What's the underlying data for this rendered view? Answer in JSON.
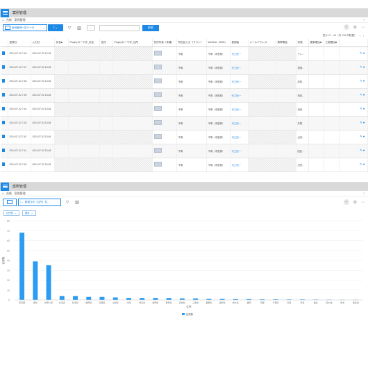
{
  "top": {
    "title": "案例管理",
    "breadcrumb": "台帐 · 案例管理",
    "breadcrumb_right": "›",
    "view_select": "案例管理一覧データ",
    "search_placeholder": "",
    "search_button": "检索",
    "dots": "…",
    "pager": "显示 21 - 40（共 795 件数据）",
    "columns": [
      "",
      "登録日",
      "入力日",
      "氏名■",
      "Pinyin(ローマ字_氏名",
      "住所",
      "Pinyin(ローマ字_住所",
      "在所写真（本通）",
      "所在区入力（ブラン）",
      "WeChat（SNS）",
      "登録者",
      "メールアドレス",
      "携帯電話",
      "状態",
      "提案理由■",
      "工程理由■",
      ""
    ],
    "rows": [
      {
        "reg": "2024-07-02 7:46",
        "input": "2024-07-02 13:48",
        "plan": "不明",
        "wechat": "不明（未登録）",
        "by": "代之信一",
        "status": "テレ…"
      },
      {
        "reg": "2024-07-02 7:47",
        "input": "2024-07-02 13:48",
        "plan": "不明",
        "wechat": "不明（未登録）",
        "by": "代之信一",
        "status": "提案…"
      },
      {
        "reg": "2024-07-02 7:46",
        "input": "2024-07-02 13:48",
        "plan": "不明",
        "wechat": "不明（未登録）",
        "by": "代之信一",
        "status": "成約…"
      },
      {
        "reg": "2024-07-02 7:45",
        "input": "2024-07-02 13:48",
        "plan": "不明",
        "wechat": "不明（未登録）",
        "by": "代之信一",
        "status": "商談…"
      },
      {
        "reg": "2024-07-02 7:44",
        "input": "2024-07-02 13:48",
        "plan": "不明",
        "wechat": "不明（未登録）",
        "by": "代之信一",
        "status": "商談…"
      },
      {
        "reg": "2024-07-02 7:43",
        "input": "2024-07-02 13:48",
        "plan": "不明",
        "wechat": "不明（未登録）",
        "by": "代之信一",
        "status": "失敗"
      },
      {
        "reg": "2024-07-02 7:42",
        "input": "2024-07-02 13:48",
        "plan": "不明",
        "wechat": "不明（未登録）",
        "by": "代之信一",
        "status": "出売…"
      },
      {
        "reg": "2024-07-02 7:41",
        "input": "2024-07-02 13:48",
        "plan": "不明",
        "wechat": "不明（未登録）",
        "by": "代之信一",
        "status": "回記…"
      },
      {
        "reg": "2024-07-02 7:40",
        "input": "2024-07-02 13:48",
        "plan": "不明",
        "wechat": "不明（未登録）",
        "by": "代之信一",
        "status": "出売…"
      }
    ]
  },
  "bottom": {
    "title": "案例管理",
    "breadcrumb": "台帐 · 案例管理",
    "breadcrumb_right": "›",
    "chart_select": "数据分析（住所）柱...",
    "filter1": "住所別",
    "filter2": "集計",
    "dots": "…"
  },
  "colors": {
    "accent": "#1e88e5",
    "bar": "#2b9cf2"
  },
  "chart_data": {
    "type": "bar",
    "categories": [
      "東京都",
      "愛知",
      "神奈川県",
      "北海道",
      "新潟県",
      "福岡県",
      "兵庫県",
      "山梨県",
      "大阪",
      "埼玉県",
      "静岡県",
      "群馬県",
      "宮城県",
      "三重県",
      "長野県",
      "滋賀県",
      "栃木県",
      "福岡",
      "京都",
      "千葉県",
      "鳥取",
      "奈良",
      "福島",
      "富士城",
      "熊本",
      "徳島県"
    ],
    "values": [
      68,
      39,
      35,
      4,
      4,
      3,
      3,
      2.5,
      2,
      2,
      2,
      2,
      1.5,
      1.5,
      1,
      1,
      0.8,
      0.8,
      0.6,
      0.6,
      0.5,
      0.5,
      0.4,
      0.3,
      0.2,
      0.2
    ],
    "ylim": [
      0,
      80
    ],
    "yticks": [
      "0",
      "10",
      "20",
      "30",
      "40",
      "50",
      "60",
      "70",
      "80"
    ],
    "ylabel": "記録数",
    "xlabel": "住所",
    "legend": "記録数",
    "legend_position": "bottom",
    "grid": true
  }
}
